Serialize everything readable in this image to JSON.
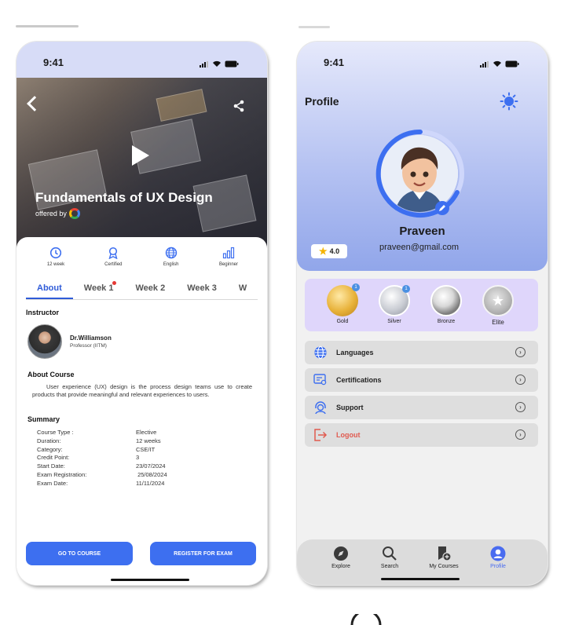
{
  "course_screen": {
    "status": {
      "time": "9:41"
    },
    "hero": {
      "title": "Fundamentals of UX Design",
      "offered_by": "offered by"
    },
    "meta": [
      {
        "icon": "clock-history-icon",
        "label": "12 week"
      },
      {
        "icon": "certificate-ribbon-icon",
        "label": "Certified"
      },
      {
        "icon": "globe-icon",
        "label": "English"
      },
      {
        "icon": "bar-chart-icon",
        "label": "Beginner"
      }
    ],
    "tabs": [
      "About",
      "Week 1",
      "Week 2",
      "Week 3",
      "W"
    ],
    "instructor": {
      "heading": "Instructor",
      "name": "Dr.Williamson",
      "role": "Professor (IITM)"
    },
    "about": {
      "heading": "About Course",
      "text": "User experience (UX) design is the process design teams use to create products that provide meaningful and relevant experiences to users."
    },
    "summary": {
      "heading": "Summary",
      "rows": [
        {
          "k": "Course Type :",
          "v": "Elective"
        },
        {
          "k": "Duration:",
          "v": "12 weeks"
        },
        {
          "k": "Category:",
          "v": "CSE/IT"
        },
        {
          "k": "Credit Point:",
          "v": "3"
        },
        {
          "k": "Start Date:",
          "v": "23/07/2024"
        },
        {
          "k": "Exam Registration:",
          "v": " 25/08/2024"
        },
        {
          "k": "Exam Date:",
          "v": "11/11/2024"
        }
      ]
    },
    "buttons": {
      "go": "GO TO COURSE",
      "register": "REGISTER FOR EXAM"
    }
  },
  "profile_screen": {
    "status": {
      "time": "9:41"
    },
    "title": "Profile",
    "name": "Praveen",
    "email": "praveen@gmail.com",
    "rating": "4.0",
    "badges": [
      {
        "label": "Gold",
        "count": "1",
        "color": "#e8b23a"
      },
      {
        "label": "Silver",
        "count": "1",
        "color": "#c9ccd3"
      },
      {
        "label": "Bronze",
        "count": "",
        "color": "#9a9a9a"
      },
      {
        "label": "Elite",
        "count": "",
        "color": "#b4b4b4"
      }
    ],
    "menu": [
      {
        "label": "Languages",
        "icon": "globe-icon"
      },
      {
        "label": "Certifications",
        "icon": "certificate-icon"
      },
      {
        "label": "Support",
        "icon": "headset-icon"
      },
      {
        "label": "Logout",
        "icon": "logout-icon"
      }
    ],
    "nav": [
      {
        "label": "Explore",
        "icon": "compass-icon"
      },
      {
        "label": "Search",
        "icon": "search-icon"
      },
      {
        "label": "My Courses",
        "icon": "book-add-icon"
      },
      {
        "label": "Profile",
        "icon": "user-icon"
      }
    ],
    "accent": "#4a6cf0",
    "logout_color": "#e05a4f"
  }
}
